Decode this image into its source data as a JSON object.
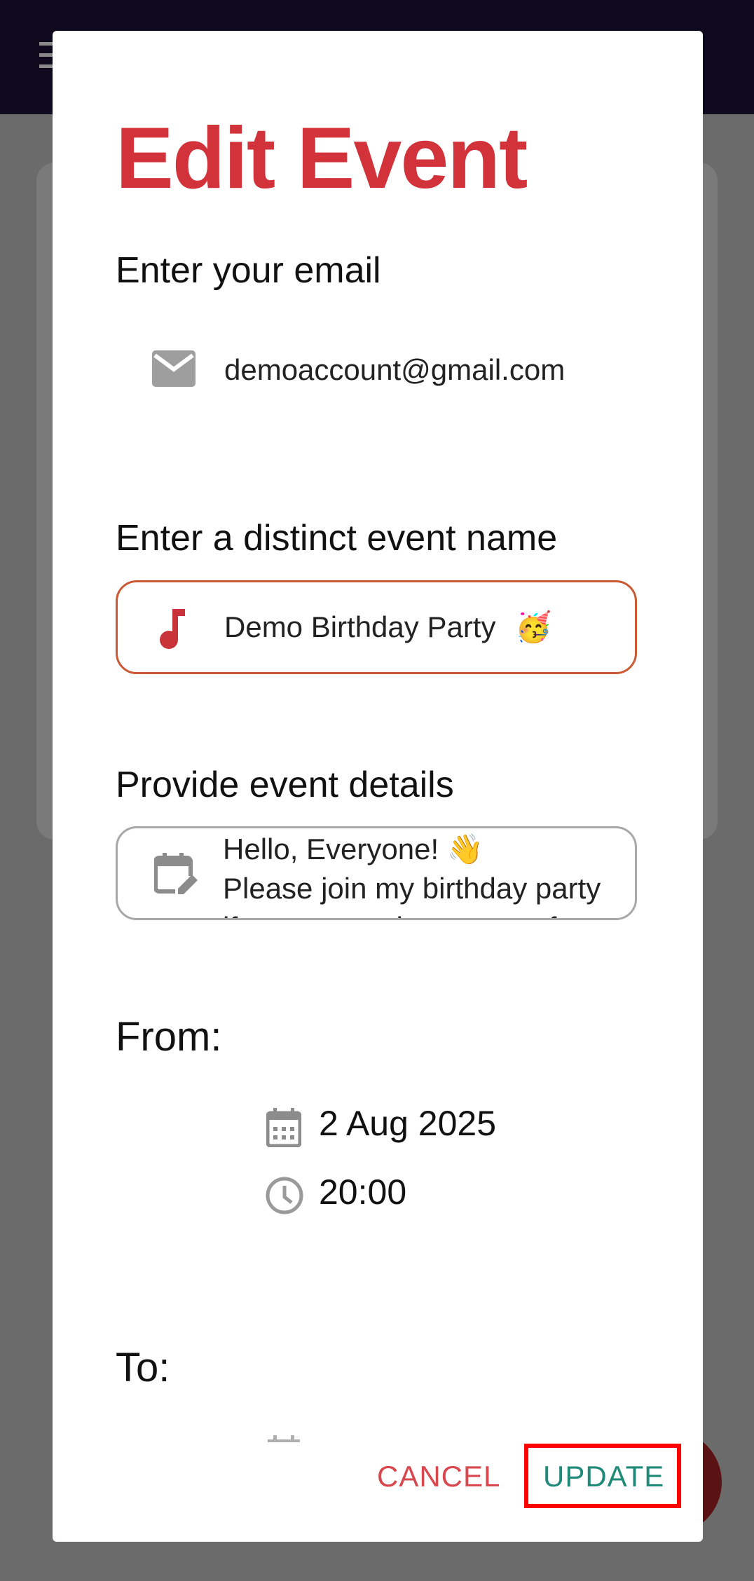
{
  "dialog": {
    "title": "Edit Event",
    "email_label": "Enter your email",
    "email_value": "demoaccount@gmail.com",
    "event_name_label": "Enter a distinct event name",
    "event_name_value": "Demo Birthday Party",
    "event_name_emoji": "🥳",
    "details_label": "Provide event details",
    "details_lines": [
      "Hello, Everyone! 👋",
      "Please join my birthday party",
      "if you wanna have some fun"
    ],
    "from_label": "From:",
    "from_date": "2 Aug 2025",
    "from_time": "20:00",
    "to_label": "To:",
    "cancel_label": "CANCEL",
    "update_label": "UPDATE"
  },
  "colors": {
    "title": "#d2333a",
    "accent_border": "#c95a34",
    "cancel": "#d9474f",
    "update": "#1f8a78",
    "highlight": "#ff0000"
  },
  "icons": {
    "email": "mail-icon",
    "event": "music-note-icon",
    "details": "calendar-edit-icon",
    "date": "calendar-icon",
    "time": "clock-icon"
  }
}
